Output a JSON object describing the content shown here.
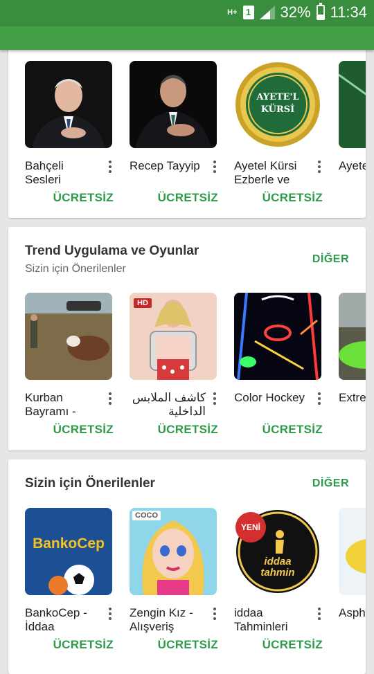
{
  "status": {
    "network": "H+",
    "sim": "1",
    "battery": "32%",
    "battery_level": 0.32,
    "time": "11:34"
  },
  "sections": [
    {
      "title": "",
      "subtitle": "",
      "more": "",
      "apps": [
        {
          "name": "Bahçeli Sesleri",
          "price": "ÜCRETSİZ"
        },
        {
          "name": "Recep Tayyip",
          "price": "ÜCRETSİZ"
        },
        {
          "name": "Ayetel Kürsi Ezberle ve",
          "price": "ÜCRETSİZ",
          "icon_text": "AYETE'L KÜRSİ"
        },
        {
          "name": "Ayete"
        }
      ]
    },
    {
      "title": "Trend Uygulama ve Oyunlar",
      "subtitle": "Sizin için Önerilenler",
      "more": "DİĞER",
      "apps": [
        {
          "name": "Kurban Bayramı -",
          "price": "ÜCRETSİZ"
        },
        {
          "name": "كاشف الملابس الداخلية",
          "price": "ÜCRETSİZ",
          "icon_text": "HD"
        },
        {
          "name": "Color Hockey",
          "price": "ÜCRETSİZ"
        },
        {
          "name": "Extre Simu"
        }
      ]
    },
    {
      "title": "Sizin için Önerilenler",
      "subtitle": "",
      "more": "DİĞER",
      "apps": [
        {
          "name": "BankoCep - İddaa",
          "price": "ÜCRETSİZ",
          "icon_text": "BankoCep"
        },
        {
          "name": "Zengin Kız - Alışveriş",
          "price": "ÜCRETSİZ",
          "icon_text": "COCO"
        },
        {
          "name": "iddaa Tahminleri",
          "price": "ÜCRETSİZ",
          "icon_text": "iddaa tahmin",
          "badge": "YENİ"
        },
        {
          "name": "Asph Nitro"
        }
      ]
    }
  ]
}
